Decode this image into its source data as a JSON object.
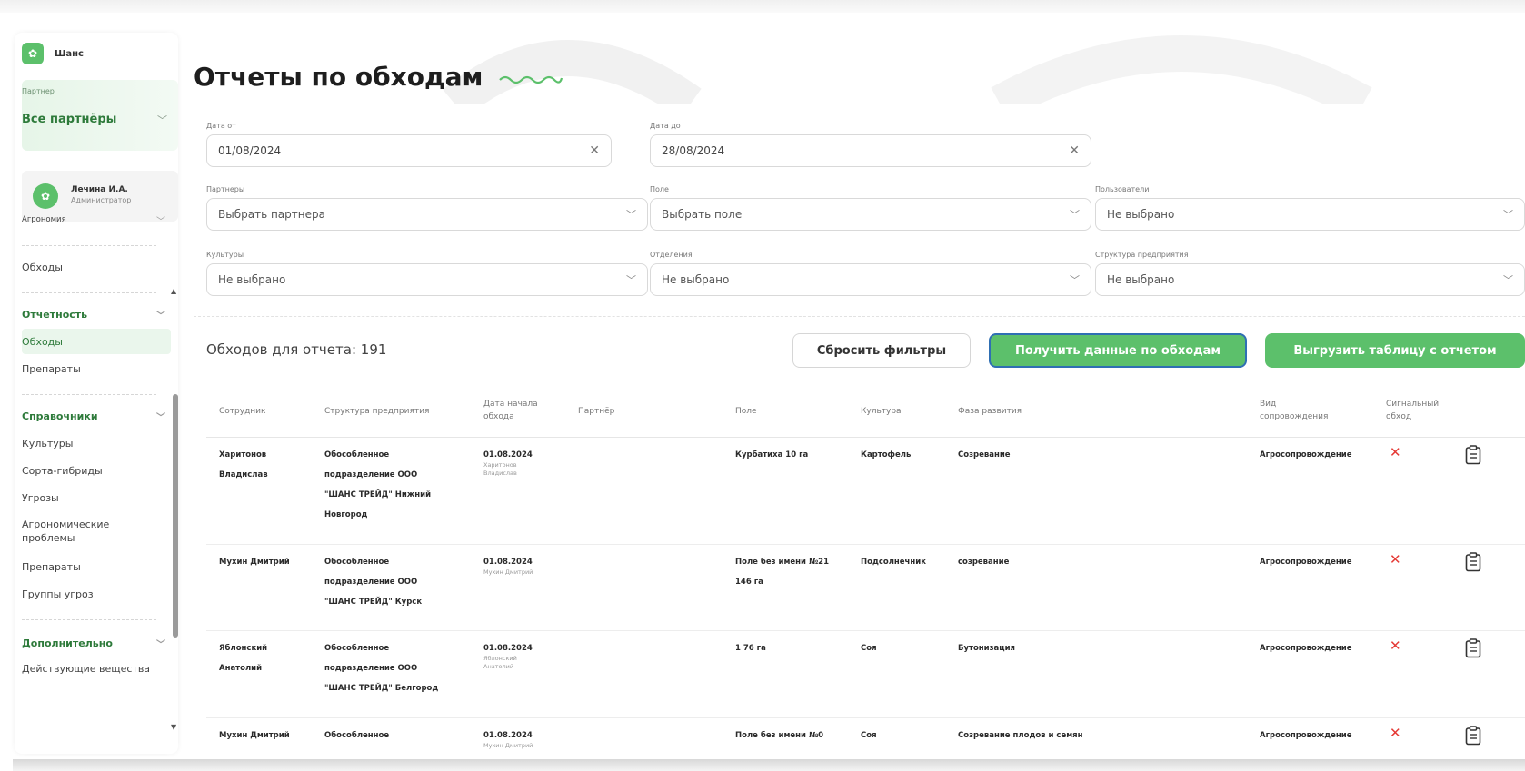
{
  "brand": {
    "name": "Шанс"
  },
  "partner": {
    "caption": "Партнер",
    "value": "Все партнёры"
  },
  "user": {
    "name": "Лечина И.А.",
    "role": "Администратор"
  },
  "nav": {
    "agronomy": "Агрономия",
    "obhody_top": "Обходы",
    "reporting": "Отчетность",
    "reporting_items": [
      "Обходы",
      "Препараты"
    ],
    "directories": "Справочники",
    "directory_items": [
      "Культуры",
      "Сорта-гибриды",
      "Угрозы",
      "Агрономические проблемы",
      "Препараты",
      "Группы угроз"
    ],
    "additional": "Дополнительно",
    "additional_items": [
      "Действующие вещества"
    ]
  },
  "page": {
    "title": "Отчеты по обходам"
  },
  "filters": {
    "date_from": {
      "label": "Дата от",
      "value": "01/08/2024"
    },
    "date_to": {
      "label": "Дата до",
      "value": "28/08/2024"
    },
    "partners": {
      "label": "Партнеры",
      "value": "Выбрать партнера"
    },
    "field": {
      "label": "Поле",
      "value": "Выбрать поле"
    },
    "users": {
      "label": "Пользователи",
      "value": "Не выбрано"
    },
    "cultures": {
      "label": "Культуры",
      "value": "Не выбрано"
    },
    "departments": {
      "label": "Отделения",
      "value": "Не выбрано"
    },
    "structure": {
      "label": "Структура предприятия",
      "value": "Не выбрано"
    }
  },
  "summary": {
    "count_text": "Обходов для отчета: 191"
  },
  "buttons": {
    "reset": "Сбросить фильтры",
    "get": "Получить данные по обходам",
    "export": "Выгрузить таблицу с отчетом"
  },
  "table": {
    "headers": {
      "employee": "Сотрудник",
      "structure": "Структура предприятия",
      "start_date_1": "Дата начала",
      "start_date_2": "обхода",
      "partner": "Партнёр",
      "field": "Поле",
      "culture": "Культура",
      "phase": "Фаза развития",
      "support_1": "Вид",
      "support_2": "сопровождения",
      "signal_1": "Сигнальный",
      "signal_2": "обход"
    },
    "rows": [
      {
        "employee_1": "Харитонов",
        "employee_2": "Владислав",
        "structure_1": "Обособленное",
        "structure_2": "подразделение ООО",
        "structure_3": "\"ШАНС ТРЕЙД\" Нижний",
        "structure_4": "Новгород",
        "date": "01.08.2024",
        "date_sub_1": "Харитонов",
        "date_sub_2": "Владислав",
        "field_1": "Курбатиха 10 га",
        "field_2": "",
        "culture": "Картофель",
        "phase": "Созревание",
        "support": "Агросопровождение"
      },
      {
        "employee_1": "Мухин Дмитрий",
        "employee_2": "",
        "structure_1": "Обособленное",
        "structure_2": "подразделение ООО",
        "structure_3": "\"ШАНС ТРЕЙД\" Курск",
        "structure_4": "",
        "date": "01.08.2024",
        "date_sub_1": "Мухин Дмитрий",
        "date_sub_2": "",
        "field_1": "Поле без имени №21",
        "field_2": "146 га",
        "culture": "Подсолнечник",
        "phase": "созревание",
        "support": "Агросопровождение"
      },
      {
        "employee_1": "Яблонский",
        "employee_2": "Анатолий",
        "structure_1": "Обособленное",
        "structure_2": "подразделение ООО",
        "structure_3": "\"ШАНС ТРЕЙД\" Белгород",
        "structure_4": "",
        "date": "01.08.2024",
        "date_sub_1": "Яблонский",
        "date_sub_2": "Анатолий",
        "field_1": "1 76 га",
        "field_2": "",
        "culture": "Соя",
        "phase": "Бутонизация",
        "support": "Агросопровождение"
      },
      {
        "employee_1": "Мухин Дмитрий",
        "employee_2": "",
        "structure_1": "Обособленное",
        "structure_2": "",
        "structure_3": "",
        "structure_4": "",
        "date": "01.08.2024",
        "date_sub_1": "Мухин Дмитрий",
        "date_sub_2": "",
        "field_1": "Поле без имени №0",
        "field_2": "",
        "culture": "Соя",
        "phase": "Созревание плодов и семян",
        "support": "Агросопровождение"
      }
    ]
  },
  "colors": {
    "accent": "#5cc06b",
    "accent_dark": "#2d7a3a",
    "danger": "#e53935"
  }
}
